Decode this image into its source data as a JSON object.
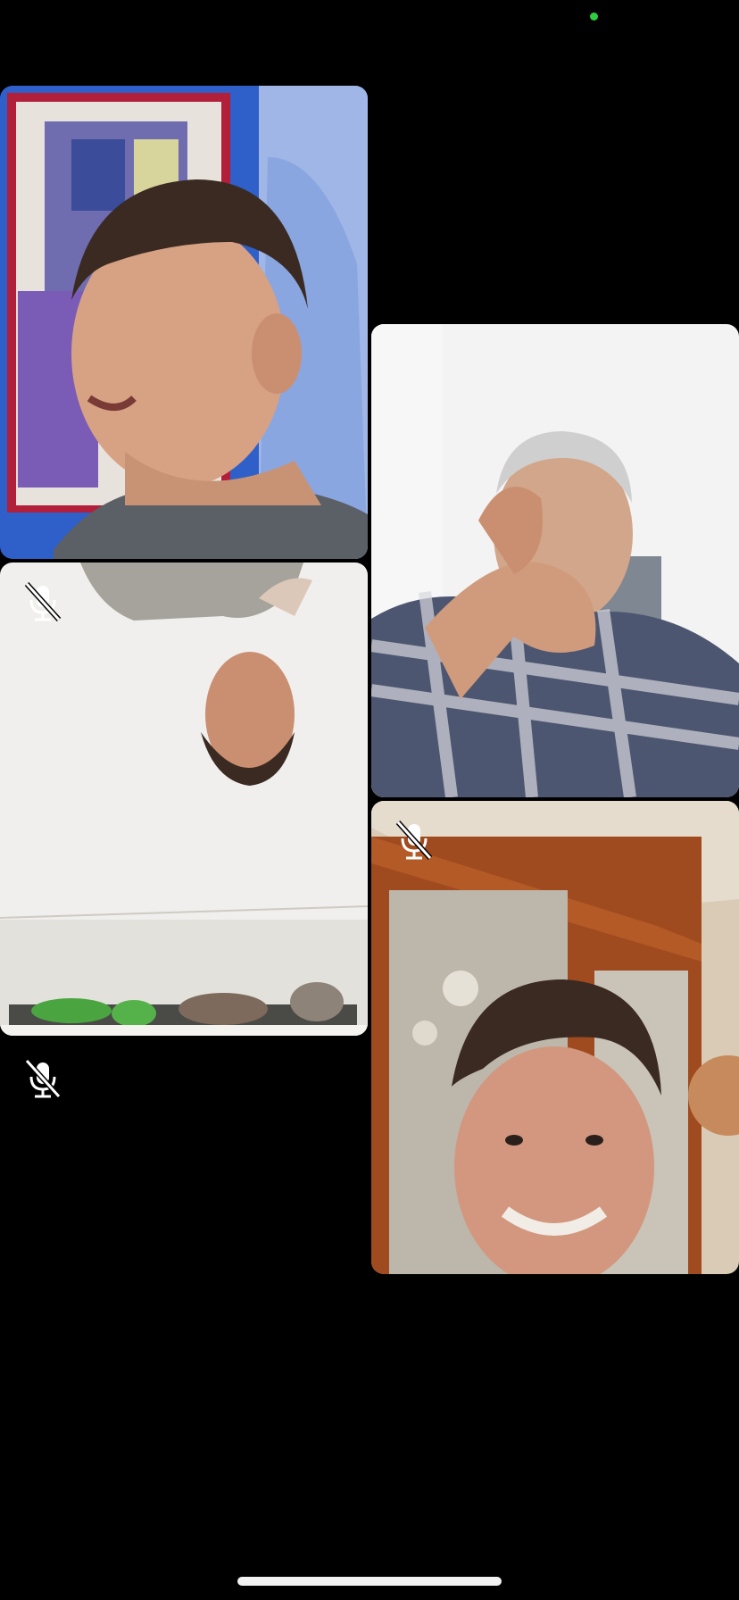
{
  "call": {
    "participants": [
      {
        "name_id": "participant-1",
        "muted": false
      },
      {
        "name_id": "participant-2",
        "muted": true
      },
      {
        "name_id": "participant-3",
        "muted": false
      },
      {
        "name_id": "participant-4",
        "muted": true
      },
      {
        "name_id": "participant-5",
        "muted": true,
        "video": "off"
      }
    ]
  },
  "icons": {
    "mute": "microphone-slash-icon",
    "status": "active-indicator-dot"
  },
  "colors": {
    "background": "#000000",
    "status_dot": "#2ecc40",
    "home_indicator": "#f2f2f2"
  }
}
